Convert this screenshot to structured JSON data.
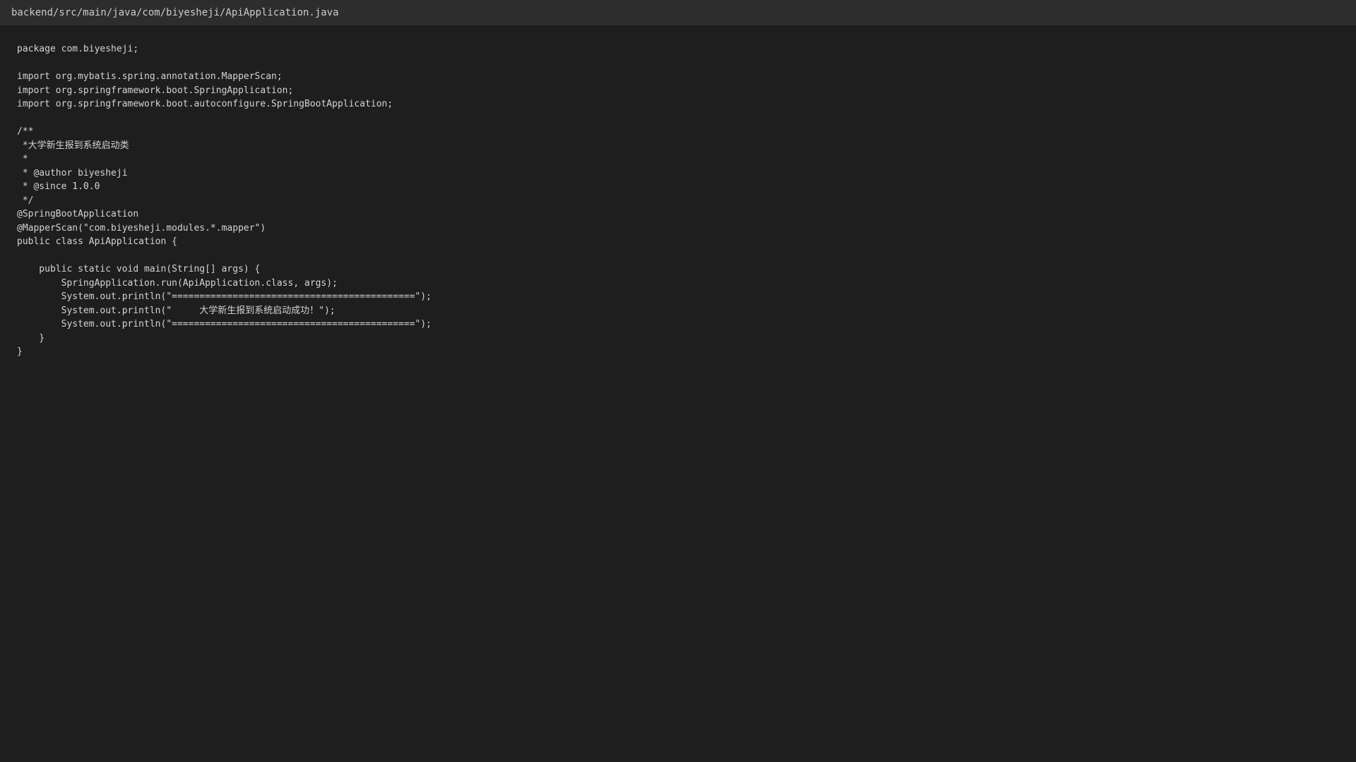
{
  "editor": {
    "file_path": "backend/src/main/java/com/biyesheji/ApiApplication.java",
    "lines": [
      "package com.biyesheji;",
      "",
      "import org.mybatis.spring.annotation.MapperScan;",
      "import org.springframework.boot.SpringApplication;",
      "import org.springframework.boot.autoconfigure.SpringBootApplication;",
      "",
      "/**",
      " *大学新生报到系统启动类",
      " *",
      " * @author biyesheji",
      " * @since 1.0.0",
      " */",
      "@SpringBootApplication",
      "@MapperScan(\"com.biyesheji.modules.*.mapper\")",
      "public class ApiApplication {",
      "",
      "    public static void main(String[] args) {",
      "        SpringApplication.run(ApiApplication.class, args);",
      "        System.out.println(\"============================================\");",
      "        System.out.println(\"     大学新生报到系统启动成功！\");",
      "        System.out.println(\"============================================\");",
      "    }",
      "}"
    ]
  }
}
